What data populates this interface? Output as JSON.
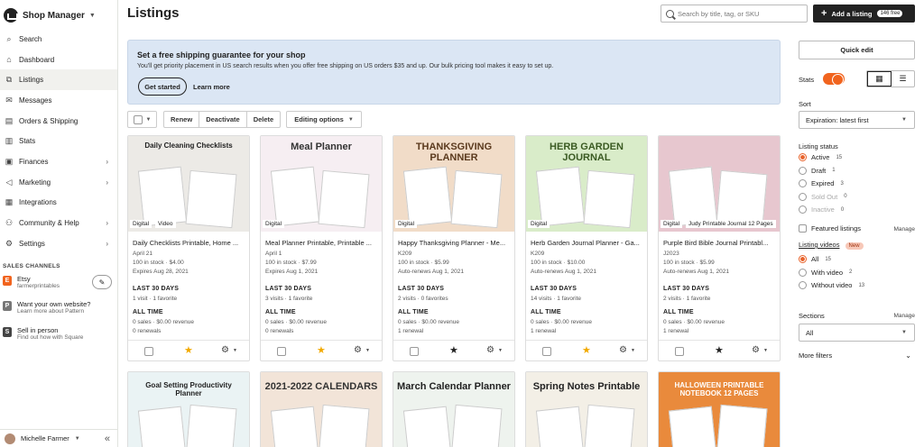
{
  "app": {
    "name": "Shop Manager"
  },
  "sidebar": {
    "items": [
      {
        "label": "Search",
        "icon": "search-icon"
      },
      {
        "label": "Dashboard",
        "icon": "home-icon"
      },
      {
        "label": "Listings",
        "icon": "listings-icon",
        "active": true
      },
      {
        "label": "Messages",
        "icon": "mail-icon"
      },
      {
        "label": "Orders & Shipping",
        "icon": "clipboard-icon"
      },
      {
        "label": "Stats",
        "icon": "bar-chart-icon"
      },
      {
        "label": "Finances",
        "icon": "bank-icon",
        "chevron": true
      },
      {
        "label": "Marketing",
        "icon": "megaphone-icon",
        "chevron": true
      },
      {
        "label": "Integrations",
        "icon": "grid-icon"
      },
      {
        "label": "Community & Help",
        "icon": "people-icon",
        "chevron": true
      },
      {
        "label": "Settings",
        "icon": "gear-icon",
        "chevron": true
      }
    ],
    "sales_channels_title": "SALES CHANNELS",
    "channels": [
      {
        "badge": "E",
        "name": "Etsy",
        "sub": "farmerprintables",
        "color": "#f1641e"
      },
      {
        "badge": "P",
        "name": "Want your own website?",
        "sub": "Learn more about Pattern",
        "color": "#777777"
      },
      {
        "badge": "S",
        "name": "Sell in person",
        "sub": "Find out how with Square",
        "color": "#444444"
      }
    ],
    "user": "Michelle Farmer",
    "collapse": "«"
  },
  "header": {
    "title": "Listings",
    "search_placeholder": "Search by title, tag, or SKU",
    "add_label": "Add a listing",
    "add_badge": "146 free"
  },
  "banner": {
    "title": "Set a free shipping guarantee for your shop",
    "text": "You'll get priority placement in US search results when you offer free shipping on US orders $35 and up. Our bulk pricing tool makes it easy to set up.",
    "cta": "Get started",
    "link": "Learn more"
  },
  "toolbar": {
    "renew": "Renew",
    "deactivate": "Deactivate",
    "delete": "Delete",
    "editing": "Editing options"
  },
  "listings": [
    {
      "thumb_title": "Daily Cleaning Checklists",
      "thumb_bg": "#eceae6",
      "thumb_fg": "#222",
      "badge": "Digital",
      "badge2": "Video",
      "title": "Daily Checklists Printable, Home ...",
      "l1": "April 21",
      "l2": "100 in stock · $4.00",
      "l3": "Expires Aug 28, 2021",
      "sec1": "LAST 30 DAYS",
      "s1": "1 visit · 1 favorite",
      "sec2": "ALL TIME",
      "s2": "0 sales · $0.00 revenue",
      "s3": "0 renewals",
      "starred": true
    },
    {
      "thumb_title": "Meal Planner",
      "thumb_bg": "#f6eef2",
      "thumb_fg": "#333",
      "badge": "Digital",
      "badge2": "",
      "title": "Meal Planner Printable, Printable ...",
      "l1": "April 1",
      "l2": "100 in stock · $7.99",
      "l3": "Expires Aug 1, 2021",
      "sec1": "LAST 30 DAYS",
      "s1": "3 visits · 1 favorite",
      "sec2": "ALL TIME",
      "s2": "0 sales · $0.00 revenue",
      "s3": "0 renewals",
      "starred": true
    },
    {
      "thumb_title": "THANKSGIVING PLANNER",
      "thumb_bg": "#f1dcc8",
      "thumb_fg": "#5b3a1e",
      "badge": "Digital",
      "badge2": "",
      "title": "Happy Thanksgiving Planner - Me...",
      "l1": "K209",
      "l2": "100 in stock · $5.99",
      "l3": "Auto-renews Aug 1, 2021",
      "sec1": "LAST 30 DAYS",
      "s1": "2 visits · 0 favorites",
      "sec2": "ALL TIME",
      "s2": "0 sales · $0.00 revenue",
      "s3": "1 renewal",
      "starred": false
    },
    {
      "thumb_title": "HERB GARDEN JOURNAL",
      "thumb_bg": "#d9ecc9",
      "thumb_fg": "#3a5a22",
      "badge": "Digital",
      "badge2": "",
      "title": "Herb Garden Journal Planner - Ga...",
      "l1": "K209",
      "l2": "100 in stock · $10.00",
      "l3": "Auto-renews Aug 1, 2021",
      "sec1": "LAST 30 DAYS",
      "s1": "14 visits · 1 favorite",
      "sec2": "ALL TIME",
      "s2": "0 sales · $0.00 revenue",
      "s3": "1 renewal",
      "starred": true
    },
    {
      "thumb_title": "",
      "thumb_bg": "#e7c7cf",
      "thumb_fg": "#333",
      "badge": "Digital",
      "badge2": "Judy Printable Journal 12 Pages",
      "title": "Purple Bird Bible Journal Printabl...",
      "l1": "J2023",
      "l2": "100 in stock · $5.99",
      "l3": "Auto-renews Aug 1, 2021",
      "sec1": "LAST 30 DAYS",
      "s1": "2 visits · 1 favorite",
      "sec2": "ALL TIME",
      "s2": "0 sales · $0.00 revenue",
      "s3": "1 renewal",
      "starred": false
    }
  ],
  "listings_row2": [
    {
      "thumb_title": "Goal Setting Productivity Planner",
      "thumb_bg": "#eaf3f4",
      "thumb_fg": "#222"
    },
    {
      "thumb_title": "2021-2022 CALENDARS",
      "thumb_bg": "#f2e4d8",
      "thumb_fg": "#333"
    },
    {
      "thumb_title": "March Calendar Planner",
      "thumb_bg": "#eef3ee",
      "thumb_fg": "#222"
    },
    {
      "thumb_title": "Spring Notes Printable",
      "thumb_bg": "#f3efe6",
      "thumb_fg": "#222"
    },
    {
      "thumb_title": "HALLOWEEN PRINTABLE NOTEBOOK 12 PAGES",
      "thumb_bg": "#e98a3c",
      "thumb_fg": "#fff"
    }
  ],
  "right_panel": {
    "quick_edit": "Quick edit",
    "stats_label": "Stats",
    "sort_label": "Sort",
    "sort_value": "Expiration: latest first",
    "status_label": "Listing status",
    "statuses": [
      {
        "label": "Active",
        "count": "15",
        "on": true,
        "muted": false
      },
      {
        "label": "Draft",
        "count": "1",
        "on": false,
        "muted": false
      },
      {
        "label": "Expired",
        "count": "3",
        "on": false,
        "muted": false
      },
      {
        "label": "Sold Out",
        "count": "0",
        "on": false,
        "muted": true
      },
      {
        "label": "Inactive",
        "count": "0",
        "on": false,
        "muted": true
      }
    ],
    "featured_label": "Featured listings",
    "manage": "Manage",
    "videos_label": "Listing videos",
    "new_badge": "New",
    "videos": [
      {
        "label": "All",
        "count": "15",
        "on": true
      },
      {
        "label": "With video",
        "count": "2",
        "on": false
      },
      {
        "label": "Without video",
        "count": "13",
        "on": false
      }
    ],
    "sections_label": "Sections",
    "sections_value": "All",
    "more_filters": "More filters"
  }
}
